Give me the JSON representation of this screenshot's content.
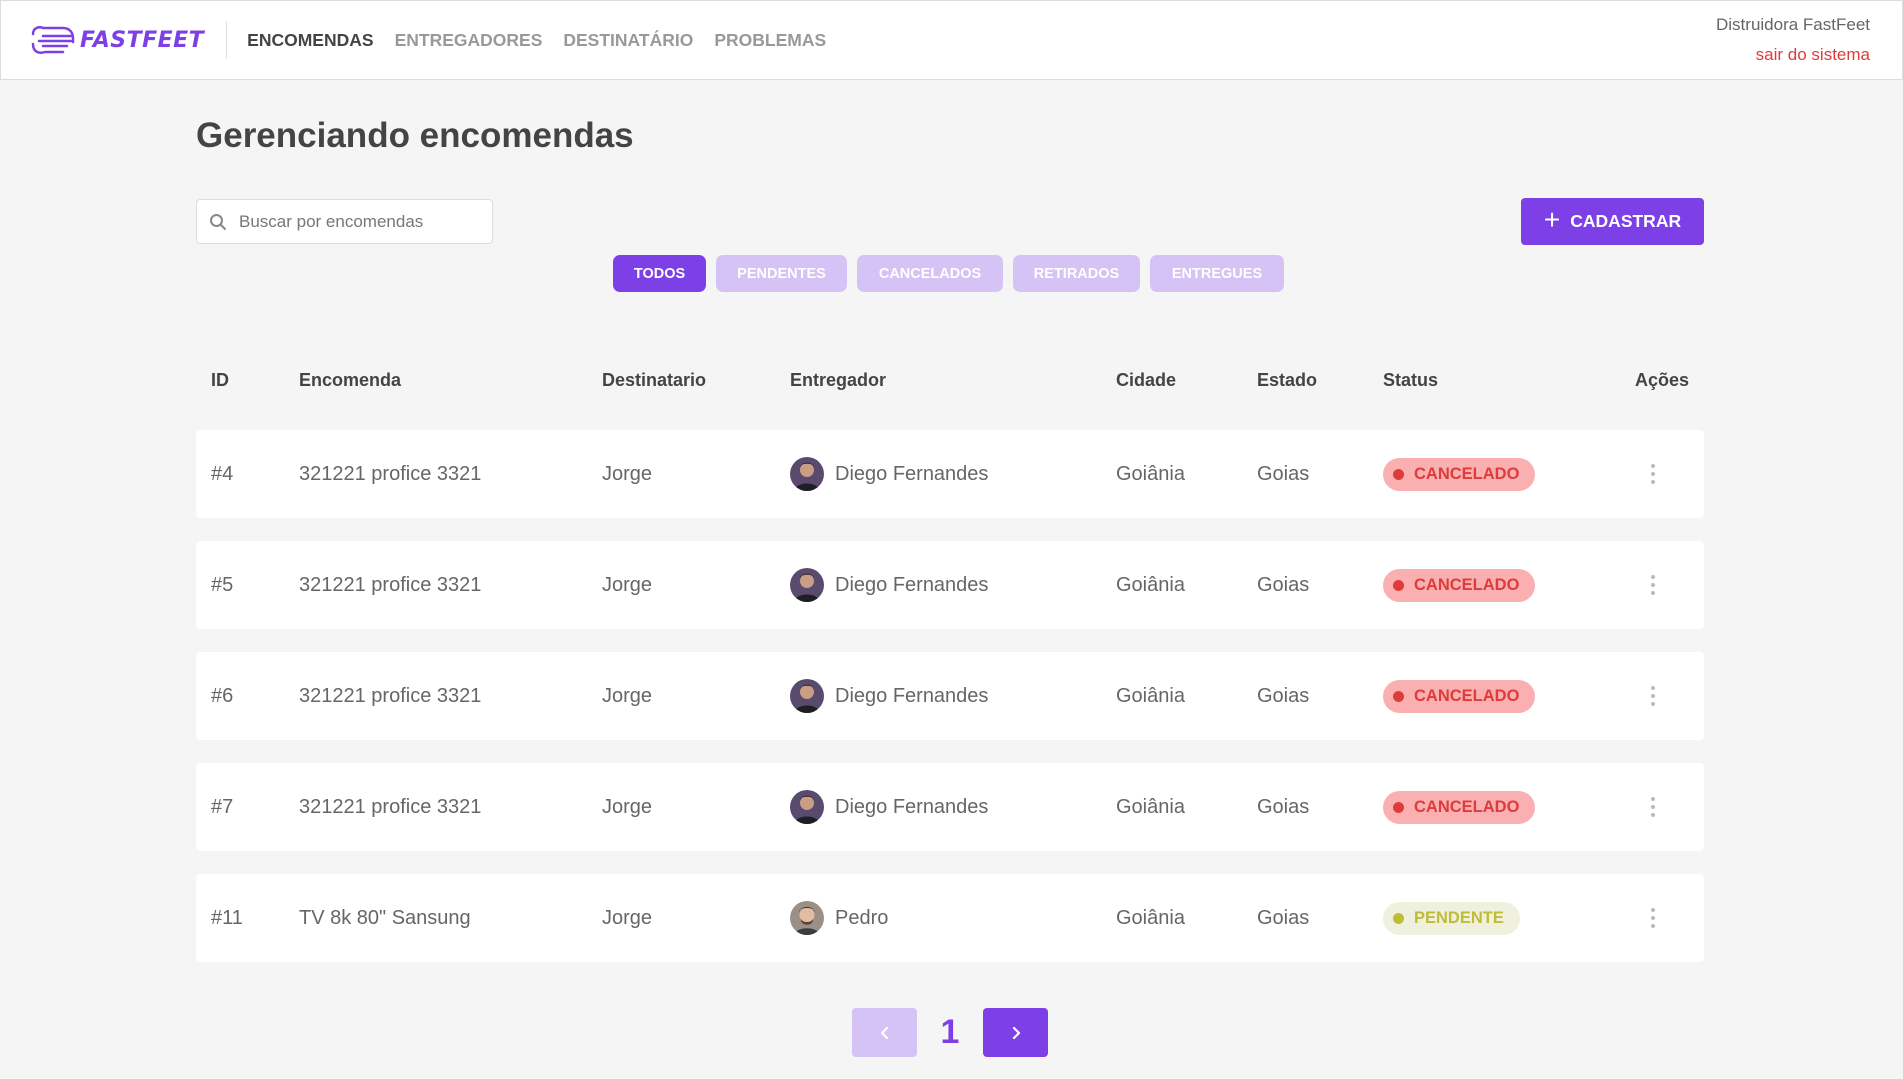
{
  "header": {
    "brand": "FASTFEET",
    "nav": [
      {
        "label": "ENCOMENDAS",
        "active": true
      },
      {
        "label": "ENTREGADORES",
        "active": false
      },
      {
        "label": "DESTINATÁRIO",
        "active": false
      },
      {
        "label": "PROBLEMAS",
        "active": false
      }
    ],
    "user_name": "Distruidora FastFeet",
    "logout_label": "sair do sistema"
  },
  "page": {
    "title": "Gerenciando encomendas",
    "search_placeholder": "Buscar por encomendas",
    "add_button_label": "CADASTRAR"
  },
  "filters": [
    {
      "label": "TODOS",
      "active": true
    },
    {
      "label": "PENDENTES",
      "active": false
    },
    {
      "label": "CANCELADOS",
      "active": false
    },
    {
      "label": "RETIRADOS",
      "active": false
    },
    {
      "label": "ENTREGUES",
      "active": false
    }
  ],
  "table": {
    "columns": [
      "ID",
      "Encomenda",
      "Destinatario",
      "Entregador",
      "Cidade",
      "Estado",
      "Status",
      "Ações"
    ],
    "rows": [
      {
        "id": "#4",
        "encomenda": "321221 profice 3321",
        "destinatario": "Jorge",
        "entregador": "Diego Fernandes",
        "avatar": "diego",
        "cidade": "Goiânia",
        "estado": "Goias",
        "status": "CANCELADO"
      },
      {
        "id": "#5",
        "encomenda": "321221 profice 3321",
        "destinatario": "Jorge",
        "entregador": "Diego Fernandes",
        "avatar": "diego",
        "cidade": "Goiânia",
        "estado": "Goias",
        "status": "CANCELADO"
      },
      {
        "id": "#6",
        "encomenda": "321221 profice 3321",
        "destinatario": "Jorge",
        "entregador": "Diego Fernandes",
        "avatar": "diego",
        "cidade": "Goiânia",
        "estado": "Goias",
        "status": "CANCELADO"
      },
      {
        "id": "#7",
        "encomenda": "321221 profice 3321",
        "destinatario": "Jorge",
        "entregador": "Diego Fernandes",
        "avatar": "diego",
        "cidade": "Goiânia",
        "estado": "Goias",
        "status": "CANCELADO"
      },
      {
        "id": "#11",
        "encomenda": "TV 8k 80\" Sansung",
        "destinatario": "Jorge",
        "entregador": "Pedro",
        "avatar": "pedro",
        "cidade": "Goiânia",
        "estado": "Goias",
        "status": "PENDENTE"
      }
    ]
  },
  "status_colors": {
    "CANCELADO": {
      "bg": "#fab0b0",
      "fg": "#de3b3b"
    },
    "PENDENTE": {
      "bg": "#f0f0df",
      "fg": "#c1bc35"
    }
  },
  "pagination": {
    "current_page": "1"
  },
  "colors": {
    "accent": "#7d40e7",
    "accent_light": "#d6c3f6",
    "danger": "#de3b3b"
  },
  "icons": {
    "logo": "fast-truck-lines-icon",
    "search": "search-icon",
    "add": "plus-icon",
    "actions": "kebab-menu-icon",
    "prev": "chevron-left-icon",
    "next": "chevron-right-icon"
  }
}
